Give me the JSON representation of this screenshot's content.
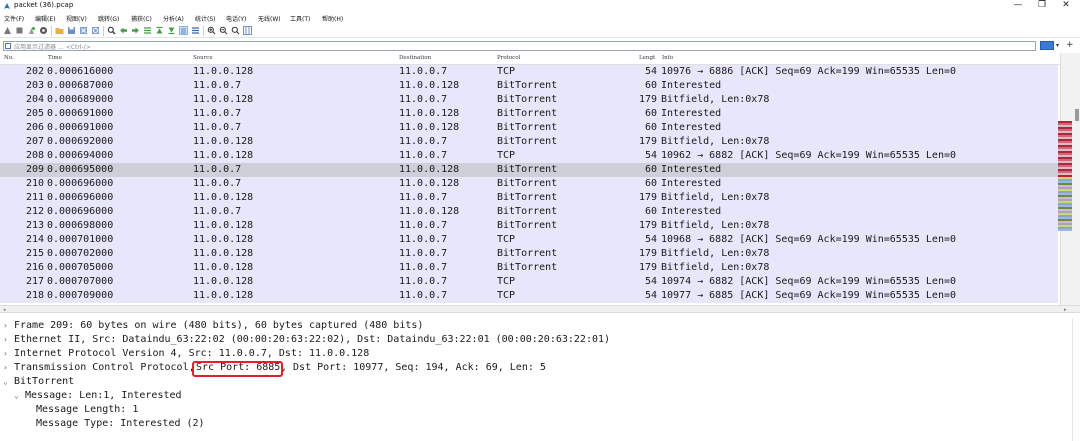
{
  "window": {
    "title": "packet (36).pcap",
    "controls": {
      "minimize": "—",
      "restore": "❐",
      "close": "✕"
    }
  },
  "menu": [
    "文件(F)",
    "编辑(E)",
    "视图(V)",
    "跳转(G)",
    "捕获(C)",
    "分析(A)",
    "统计(S)",
    "电话(Y)",
    "无线(W)",
    "工具(T)",
    "帮助(H)"
  ],
  "filter": {
    "placeholder": "应用显示过滤器 … <Ctrl-/>"
  },
  "columns": {
    "no": "No.",
    "time": "Time",
    "source": "Source",
    "destination": "Destination",
    "protocol": "Protocol",
    "length": "Lengt",
    "info": "Info"
  },
  "packets": [
    {
      "no": "202",
      "time": "0.000616000",
      "src": "11.0.0.128",
      "dst": "11.0.0.7",
      "proto": "TCP",
      "len": "54",
      "info": "10976 → 6886 [ACK] Seq=69 Ack=199 Win=65535 Len=0"
    },
    {
      "no": "203",
      "time": "0.000687000",
      "src": "11.0.0.7",
      "dst": "11.0.0.128",
      "proto": "BitTorrent",
      "len": "60",
      "info": "Interested"
    },
    {
      "no": "204",
      "time": "0.000689000",
      "src": "11.0.0.128",
      "dst": "11.0.0.7",
      "proto": "BitTorrent",
      "len": "179",
      "info": "Bitfield, Len:0x78"
    },
    {
      "no": "205",
      "time": "0.000691000",
      "src": "11.0.0.7",
      "dst": "11.0.0.128",
      "proto": "BitTorrent",
      "len": "60",
      "info": "Interested"
    },
    {
      "no": "206",
      "time": "0.000691000",
      "src": "11.0.0.7",
      "dst": "11.0.0.128",
      "proto": "BitTorrent",
      "len": "60",
      "info": "Interested"
    },
    {
      "no": "207",
      "time": "0.000692000",
      "src": "11.0.0.128",
      "dst": "11.0.0.7",
      "proto": "BitTorrent",
      "len": "179",
      "info": "Bitfield, Len:0x78"
    },
    {
      "no": "208",
      "time": "0.000694000",
      "src": "11.0.0.128",
      "dst": "11.0.0.7",
      "proto": "TCP",
      "len": "54",
      "info": "10962 → 6882 [ACK] Seq=69 Ack=199 Win=65535 Len=0"
    },
    {
      "no": "209",
      "time": "0.000695000",
      "src": "11.0.0.7",
      "dst": "11.0.0.128",
      "proto": "BitTorrent",
      "len": "60",
      "info": "Interested",
      "selected": true
    },
    {
      "no": "210",
      "time": "0.000696000",
      "src": "11.0.0.7",
      "dst": "11.0.0.128",
      "proto": "BitTorrent",
      "len": "60",
      "info": "Interested"
    },
    {
      "no": "211",
      "time": "0.000696000",
      "src": "11.0.0.128",
      "dst": "11.0.0.7",
      "proto": "BitTorrent",
      "len": "179",
      "info": "Bitfield, Len:0x78"
    },
    {
      "no": "212",
      "time": "0.000696000",
      "src": "11.0.0.7",
      "dst": "11.0.0.128",
      "proto": "BitTorrent",
      "len": "60",
      "info": "Interested"
    },
    {
      "no": "213",
      "time": "0.000698000",
      "src": "11.0.0.128",
      "dst": "11.0.0.7",
      "proto": "BitTorrent",
      "len": "179",
      "info": "Bitfield, Len:0x78"
    },
    {
      "no": "214",
      "time": "0.000701000",
      "src": "11.0.0.128",
      "dst": "11.0.0.7",
      "proto": "TCP",
      "len": "54",
      "info": "10968 → 6882 [ACK] Seq=69 Ack=199 Win=65535 Len=0"
    },
    {
      "no": "215",
      "time": "0.000702000",
      "src": "11.0.0.128",
      "dst": "11.0.0.7",
      "proto": "BitTorrent",
      "len": "179",
      "info": "Bitfield, Len:0x78"
    },
    {
      "no": "216",
      "time": "0.000705000",
      "src": "11.0.0.128",
      "dst": "11.0.0.7",
      "proto": "BitTorrent",
      "len": "179",
      "info": "Bitfield, Len:0x78"
    },
    {
      "no": "217",
      "time": "0.000707000",
      "src": "11.0.0.128",
      "dst": "11.0.0.7",
      "proto": "TCP",
      "len": "54",
      "info": "10974 → 6882 [ACK] Seq=69 Ack=199 Win=65535 Len=0"
    },
    {
      "no": "218",
      "time": "0.000709000",
      "src": "11.0.0.128",
      "dst": "11.0.0.7",
      "proto": "TCP",
      "len": "54",
      "info": "10977 → 6885 [ACK] Seq=69 Ack=199 Win=65535 Len=0"
    }
  ],
  "details": {
    "frame": "Frame 209: 60 bytes on wire (480 bits), 60 bytes captured (480 bits)",
    "ethernet": "Ethernet II, Src: Dataindu_63:22:02 (00:00:20:63:22:02), Dst: Dataindu_63:22:01 (00:00:20:63:22:01)",
    "ip": "Internet Protocol Version 4, Src: 11.0.0.7, Dst: 11.0.0.128",
    "tcp_prefix": "Transmission Control Protocol, ",
    "tcp_src_port": "Src Port: 6885",
    "tcp_rest": ", Dst Port: 10977, Seq: 194, Ack: 69, Len: 5",
    "bittorrent": "BitTorrent",
    "message": "Message: Len:1, Interested",
    "message_length": "Message Length: 1",
    "message_type": "Message Type: Interested (2)"
  },
  "colors": {
    "row_bg": "#e7e6fb",
    "row_selected": "#cfcfd9",
    "highlight": "#e5202a"
  }
}
